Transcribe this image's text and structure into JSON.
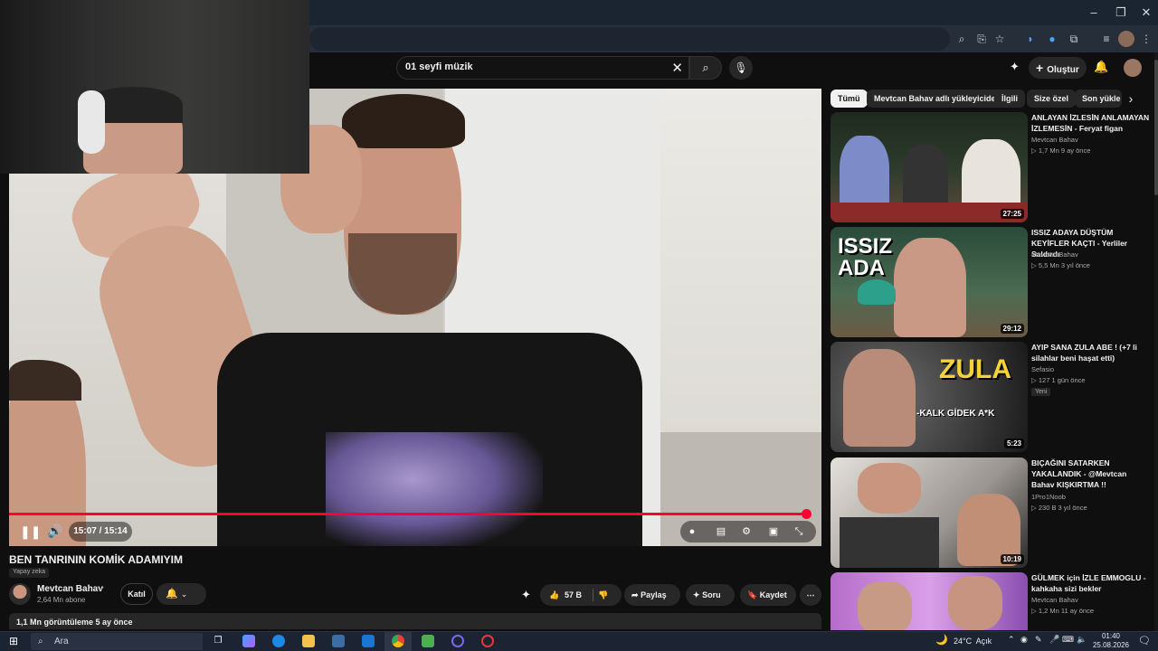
{
  "search": {
    "query": "01 seyfi müzik"
  },
  "header": {
    "create_label": "Oluştur"
  },
  "player": {
    "time": "15:07 / 15:14",
    "progress": 0.992
  },
  "video": {
    "title": "BEN TANRININ KOMİK ADAMIYIM",
    "ai_badge": "Yapay zeka",
    "channel": "Mevtcan Bahav",
    "subscribers": "2,64 Mn abone",
    "join_label": "Katıl",
    "likes": "57 B",
    "share_label": "Paylaş",
    "ask_label": "Soru",
    "save_label": "Kaydet",
    "views_line": "1,1 Mn görüntüleme  5 ay önce"
  },
  "chips": [
    "Tümü",
    "Mevtcan Bahav adlı yükleyiciden",
    "İlgili",
    "Size özel",
    "Son yükle"
  ],
  "related": [
    {
      "title": "ANLAYAN İZLESİN ANLAMAYAN İZLEMESİN - Feryat figan",
      "channel": "Mevtcan Bahav",
      "meta": "▷ 1,7 Mn   9 ay önce",
      "duration": "27:25"
    },
    {
      "title": "ISSIZ ADAYA DÜŞTÜM KEYİFLER KAÇTI - Yerliler Saldırdı",
      "channel": "Mevtcan Bahav",
      "meta": "▷ 5,5 Mn   3 yıl önce",
      "duration": "29:12",
      "thumb_text": "ISSIZ ADA"
    },
    {
      "title": "AYIP SANA ZULA ABE ! (+7 li silahlar beni haşat etti)",
      "channel": "Sefasio",
      "meta": "▷ 127   1 gün önce",
      "duration": "5:23",
      "badge": "Yeni",
      "thumb_text": "ZULA",
      "thumb_sub": "-KALK GİDEK A*K"
    },
    {
      "title": "BIÇAĞINI SATARKEN YAKALANDIK - @Mevtcan Bahav KIŞKIRTMA !!",
      "channel": "1Pro1Noob",
      "meta": "▷ 230 B   3 yıl önce",
      "duration": "10:19"
    },
    {
      "title": "GÜLMEK için İZLE EMMOGLU - kahkaha sizi bekler",
      "channel": "Mevtcan Bahav",
      "meta": "▷ 1,2 Mn   11 ay önce"
    }
  ],
  "taskbar": {
    "search_placeholder": "Ara",
    "weather": "24°C  Açık",
    "time": "01:40",
    "date": "25.08.2026"
  },
  "colors": {
    "accent": "#ff0033",
    "background": "#0f0f0f",
    "chip": "#272727"
  }
}
